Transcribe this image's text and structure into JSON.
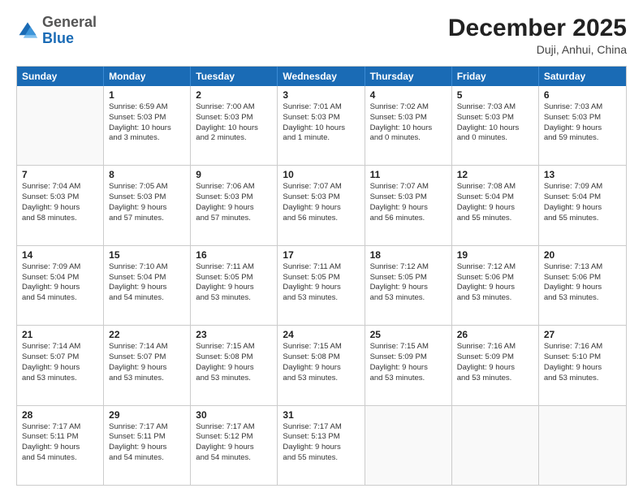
{
  "header": {
    "logo_general": "General",
    "logo_blue": "Blue",
    "month_title": "December 2025",
    "location": "Duji, Anhui, China"
  },
  "weekdays": [
    "Sunday",
    "Monday",
    "Tuesday",
    "Wednesday",
    "Thursday",
    "Friday",
    "Saturday"
  ],
  "rows": [
    [
      {
        "day": "",
        "lines": []
      },
      {
        "day": "1",
        "lines": [
          "Sunrise: 6:59 AM",
          "Sunset: 5:03 PM",
          "Daylight: 10 hours",
          "and 3 minutes."
        ]
      },
      {
        "day": "2",
        "lines": [
          "Sunrise: 7:00 AM",
          "Sunset: 5:03 PM",
          "Daylight: 10 hours",
          "and 2 minutes."
        ]
      },
      {
        "day": "3",
        "lines": [
          "Sunrise: 7:01 AM",
          "Sunset: 5:03 PM",
          "Daylight: 10 hours",
          "and 1 minute."
        ]
      },
      {
        "day": "4",
        "lines": [
          "Sunrise: 7:02 AM",
          "Sunset: 5:03 PM",
          "Daylight: 10 hours",
          "and 0 minutes."
        ]
      },
      {
        "day": "5",
        "lines": [
          "Sunrise: 7:03 AM",
          "Sunset: 5:03 PM",
          "Daylight: 10 hours",
          "and 0 minutes."
        ]
      },
      {
        "day": "6",
        "lines": [
          "Sunrise: 7:03 AM",
          "Sunset: 5:03 PM",
          "Daylight: 9 hours",
          "and 59 minutes."
        ]
      }
    ],
    [
      {
        "day": "7",
        "lines": [
          "Sunrise: 7:04 AM",
          "Sunset: 5:03 PM",
          "Daylight: 9 hours",
          "and 58 minutes."
        ]
      },
      {
        "day": "8",
        "lines": [
          "Sunrise: 7:05 AM",
          "Sunset: 5:03 PM",
          "Daylight: 9 hours",
          "and 57 minutes."
        ]
      },
      {
        "day": "9",
        "lines": [
          "Sunrise: 7:06 AM",
          "Sunset: 5:03 PM",
          "Daylight: 9 hours",
          "and 57 minutes."
        ]
      },
      {
        "day": "10",
        "lines": [
          "Sunrise: 7:07 AM",
          "Sunset: 5:03 PM",
          "Daylight: 9 hours",
          "and 56 minutes."
        ]
      },
      {
        "day": "11",
        "lines": [
          "Sunrise: 7:07 AM",
          "Sunset: 5:03 PM",
          "Daylight: 9 hours",
          "and 56 minutes."
        ]
      },
      {
        "day": "12",
        "lines": [
          "Sunrise: 7:08 AM",
          "Sunset: 5:04 PM",
          "Daylight: 9 hours",
          "and 55 minutes."
        ]
      },
      {
        "day": "13",
        "lines": [
          "Sunrise: 7:09 AM",
          "Sunset: 5:04 PM",
          "Daylight: 9 hours",
          "and 55 minutes."
        ]
      }
    ],
    [
      {
        "day": "14",
        "lines": [
          "Sunrise: 7:09 AM",
          "Sunset: 5:04 PM",
          "Daylight: 9 hours",
          "and 54 minutes."
        ]
      },
      {
        "day": "15",
        "lines": [
          "Sunrise: 7:10 AM",
          "Sunset: 5:04 PM",
          "Daylight: 9 hours",
          "and 54 minutes."
        ]
      },
      {
        "day": "16",
        "lines": [
          "Sunrise: 7:11 AM",
          "Sunset: 5:05 PM",
          "Daylight: 9 hours",
          "and 53 minutes."
        ]
      },
      {
        "day": "17",
        "lines": [
          "Sunrise: 7:11 AM",
          "Sunset: 5:05 PM",
          "Daylight: 9 hours",
          "and 53 minutes."
        ]
      },
      {
        "day": "18",
        "lines": [
          "Sunrise: 7:12 AM",
          "Sunset: 5:05 PM",
          "Daylight: 9 hours",
          "and 53 minutes."
        ]
      },
      {
        "day": "19",
        "lines": [
          "Sunrise: 7:12 AM",
          "Sunset: 5:06 PM",
          "Daylight: 9 hours",
          "and 53 minutes."
        ]
      },
      {
        "day": "20",
        "lines": [
          "Sunrise: 7:13 AM",
          "Sunset: 5:06 PM",
          "Daylight: 9 hours",
          "and 53 minutes."
        ]
      }
    ],
    [
      {
        "day": "21",
        "lines": [
          "Sunrise: 7:14 AM",
          "Sunset: 5:07 PM",
          "Daylight: 9 hours",
          "and 53 minutes."
        ]
      },
      {
        "day": "22",
        "lines": [
          "Sunrise: 7:14 AM",
          "Sunset: 5:07 PM",
          "Daylight: 9 hours",
          "and 53 minutes."
        ]
      },
      {
        "day": "23",
        "lines": [
          "Sunrise: 7:15 AM",
          "Sunset: 5:08 PM",
          "Daylight: 9 hours",
          "and 53 minutes."
        ]
      },
      {
        "day": "24",
        "lines": [
          "Sunrise: 7:15 AM",
          "Sunset: 5:08 PM",
          "Daylight: 9 hours",
          "and 53 minutes."
        ]
      },
      {
        "day": "25",
        "lines": [
          "Sunrise: 7:15 AM",
          "Sunset: 5:09 PM",
          "Daylight: 9 hours",
          "and 53 minutes."
        ]
      },
      {
        "day": "26",
        "lines": [
          "Sunrise: 7:16 AM",
          "Sunset: 5:09 PM",
          "Daylight: 9 hours",
          "and 53 minutes."
        ]
      },
      {
        "day": "27",
        "lines": [
          "Sunrise: 7:16 AM",
          "Sunset: 5:10 PM",
          "Daylight: 9 hours",
          "and 53 minutes."
        ]
      }
    ],
    [
      {
        "day": "28",
        "lines": [
          "Sunrise: 7:17 AM",
          "Sunset: 5:11 PM",
          "Daylight: 9 hours",
          "and 54 minutes."
        ]
      },
      {
        "day": "29",
        "lines": [
          "Sunrise: 7:17 AM",
          "Sunset: 5:11 PM",
          "Daylight: 9 hours",
          "and 54 minutes."
        ]
      },
      {
        "day": "30",
        "lines": [
          "Sunrise: 7:17 AM",
          "Sunset: 5:12 PM",
          "Daylight: 9 hours",
          "and 54 minutes."
        ]
      },
      {
        "day": "31",
        "lines": [
          "Sunrise: 7:17 AM",
          "Sunset: 5:13 PM",
          "Daylight: 9 hours",
          "and 55 minutes."
        ]
      },
      {
        "day": "",
        "lines": []
      },
      {
        "day": "",
        "lines": []
      },
      {
        "day": "",
        "lines": []
      }
    ]
  ]
}
